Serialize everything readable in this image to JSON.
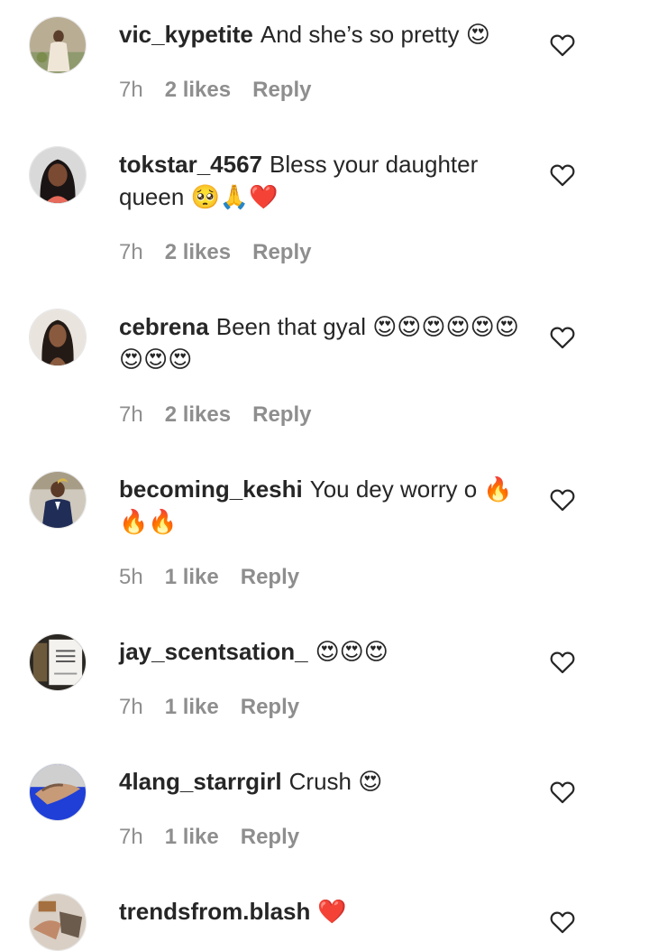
{
  "comments": [
    {
      "username": "vic_kypetite",
      "text": "And she’s so pretty 😍",
      "time": "7h",
      "likes": "2 likes",
      "reply": "Reply"
    },
    {
      "username": "tokstar_4567",
      "text": "Bless your daughter queen 🥺🙏❤️",
      "time": "7h",
      "likes": "2 likes",
      "reply": "Reply"
    },
    {
      "username": "cebrena",
      "text": "Been that gyal 😍😍😍😍😍😍😍😍😍",
      "time": "7h",
      "likes": "2 likes",
      "reply": "Reply"
    },
    {
      "username": "becoming_keshi",
      "text": "You dey worry o 🔥🔥🔥",
      "time": "5h",
      "likes": "1 like",
      "reply": "Reply"
    },
    {
      "username": "jay_scentsation_",
      "text": "😍😍😍",
      "time": "7h",
      "likes": "1 like",
      "reply": "Reply"
    },
    {
      "username": "4lang_starrgirl",
      "text": "Crush 😍",
      "time": "7h",
      "likes": "1 like",
      "reply": "Reply"
    },
    {
      "username": "trendsfrom.blash",
      "text": "❤️"
    }
  ],
  "icons": {
    "like": "heart-outline-icon"
  },
  "colors": {
    "text": "#262626",
    "muted": "#8e8e8e"
  }
}
